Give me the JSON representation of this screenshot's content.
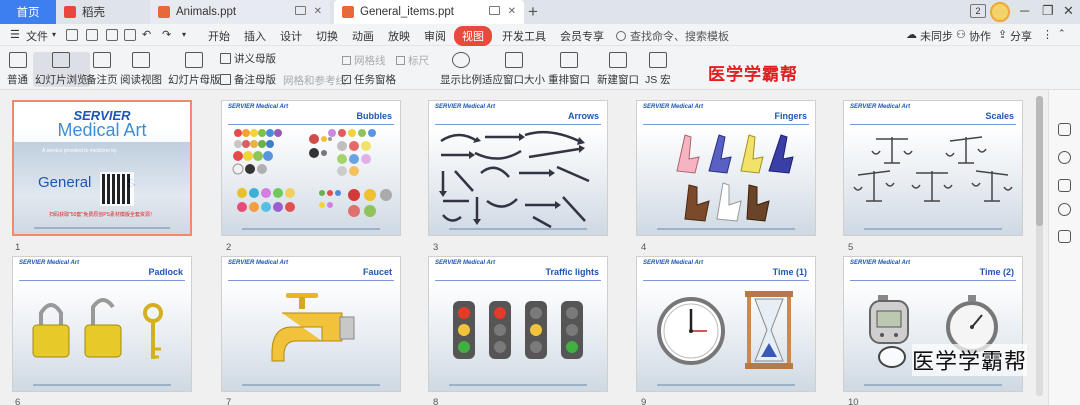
{
  "tabs": {
    "home": "首页",
    "daoke": "稻壳",
    "animals": "Animals.ppt",
    "general": "General_items.ppt",
    "badge": "2"
  },
  "menu": {
    "file": "文件",
    "items": [
      "开始",
      "插入",
      "设计",
      "切换",
      "动画",
      "放映",
      "审阅",
      "视图",
      "开发工具",
      "会员专享"
    ],
    "active_index": 7,
    "search": "查找命令、搜索模板",
    "sync": "未同步",
    "collab": "协作",
    "share": "分享"
  },
  "ribbon": {
    "normal": "普通",
    "slide_browse": "幻灯片浏览",
    "notes_page": "备注页",
    "reading_view": "阅读视图",
    "slide_master": "幻灯片母版",
    "handout_master": "讲义母版",
    "notes_master": "备注母版",
    "gridlines": "网格线",
    "ruler": "标尺",
    "grid_and_guides": "网格和参考线",
    "task_pane": "任务窗格",
    "zoom": "显示比例",
    "fit_window": "适应窗口大小",
    "arrange_windows": "重排窗口",
    "new_window": "新建窗口",
    "js_macro": "JS 宏"
  },
  "brand_text": "医学学霸帮",
  "watermark_text": "医学学霸帮",
  "slides": [
    {
      "num": "1",
      "title": "",
      "selected": true
    },
    {
      "num": "2",
      "title": "Bubbles"
    },
    {
      "num": "3",
      "title": "Arrows"
    },
    {
      "num": "4",
      "title": "Fingers"
    },
    {
      "num": "5",
      "title": "Scales"
    },
    {
      "num": "6",
      "title": "Padlock"
    },
    {
      "num": "7",
      "title": "Faucet"
    },
    {
      "num": "8",
      "title": "Traffic lights"
    },
    {
      "num": "9",
      "title": "Time (1)"
    },
    {
      "num": "10",
      "title": "Time (2)"
    }
  ],
  "slide_header": "SERVIER Medical Art",
  "slide1": {
    "servier": "SERVIER",
    "medical_art": "Medical Art",
    "tagline": "A service provided to medicine by",
    "general": "General",
    "suffix": "s",
    "promo": "扫码获取\"50套\"免费原创PS素材模版全套资源！"
  }
}
